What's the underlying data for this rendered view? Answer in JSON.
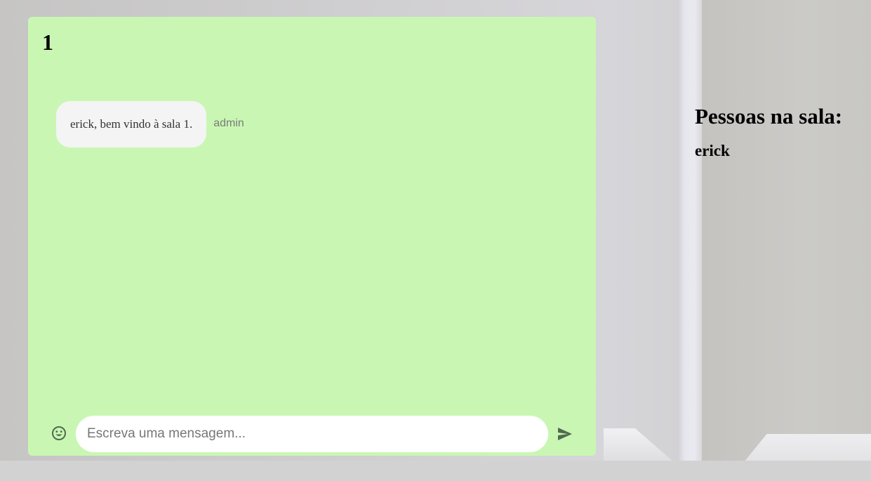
{
  "chat": {
    "room_title": "1",
    "messages": [
      {
        "text": "erick, bem vindo à sala 1.",
        "author": "admin"
      }
    ],
    "composer": {
      "placeholder": "Escreva uma mensagem...",
      "value": "",
      "emoji_icon": "smiley-icon",
      "send_icon": "send-icon"
    }
  },
  "people": {
    "title": "Pessoas na sala:",
    "users": [
      "erick"
    ]
  },
  "colors": {
    "chat_background": "#c9f7b3",
    "bubble_background": "#f4f4f4",
    "icon_color": "#4f6b4f"
  }
}
